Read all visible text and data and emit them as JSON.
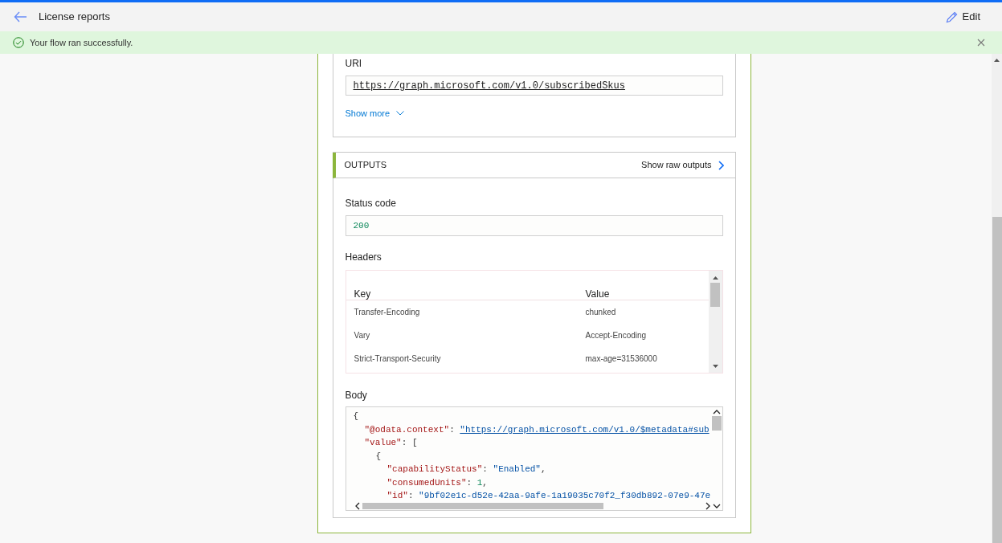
{
  "header": {
    "title": "License reports",
    "edit_label": "Edit"
  },
  "banner": {
    "message": "Your flow ran successfully."
  },
  "inputs": {
    "uri_label": "URI",
    "uri": "https://graph.microsoft.com/v1.0/subscribedSkus",
    "show_more": "Show more"
  },
  "outputs": {
    "title": "OUTPUTS",
    "raw_link": "Show raw outputs",
    "status_label": "Status code",
    "status_code": "200",
    "headers_label": "Headers",
    "headers_columns": [
      "Key",
      "Value"
    ],
    "headers_rows": [
      {
        "key": "Transfer-Encoding",
        "value": "chunked"
      },
      {
        "key": "Vary",
        "value": "Accept-Encoding"
      },
      {
        "key": "Strict-Transport-Security",
        "value": "max-age=31536000"
      }
    ],
    "body_label": "Body",
    "body_lines": [
      {
        "tokens": [
          {
            "kind": "punct",
            "text": "{"
          }
        ],
        "children": [
          {
            "tokens": [
              {
                "kind": "key",
                "text": "\"@odata.context\""
              },
              {
                "kind": "punct",
                "text": ": "
              },
              {
                "kind": "link",
                "text": "\"https://graph.microsoft.com/v1.0/$metadata#sub"
              }
            ]
          },
          {
            "tokens": [
              {
                "kind": "key",
                "text": "\"value\""
              },
              {
                "kind": "punct",
                "text": ": ["
              }
            ],
            "children": [
              {
                "tokens": [
                  {
                    "kind": "punct",
                    "text": "{"
                  }
                ],
                "children": [
                  {
                    "tokens": [
                      {
                        "kind": "key",
                        "text": "\"capabilityStatus\""
                      },
                      {
                        "kind": "punct",
                        "text": ": "
                      },
                      {
                        "kind": "string",
                        "text": "\"Enabled\""
                      },
                      {
                        "kind": "punct",
                        "text": ","
                      }
                    ]
                  },
                  {
                    "tokens": [
                      {
                        "kind": "key",
                        "text": "\"consumedUnits\""
                      },
                      {
                        "kind": "punct",
                        "text": ": "
                      },
                      {
                        "kind": "number",
                        "text": "1"
                      },
                      {
                        "kind": "punct",
                        "text": ","
                      }
                    ]
                  },
                  {
                    "tokens": [
                      {
                        "kind": "key",
                        "text": "\"id\""
                      },
                      {
                        "kind": "punct",
                        "text": ": "
                      },
                      {
                        "kind": "string",
                        "text": "\"9bf02e1c-d52e-42aa-9afe-1a19035c70f2_f30db892-07e9-47e"
                      }
                    ]
                  }
                ]
              }
            ]
          }
        ]
      }
    ]
  }
}
